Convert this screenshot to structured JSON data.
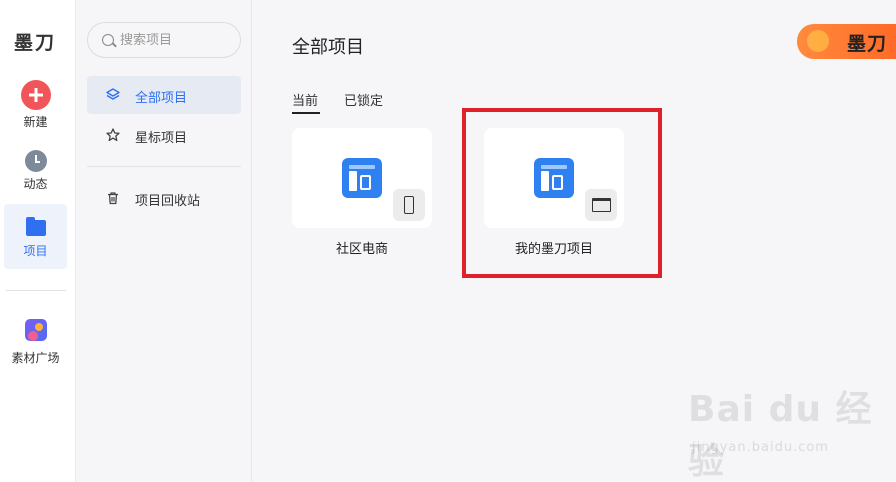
{
  "rail": {
    "logo": "墨刀",
    "items": [
      {
        "label": "新建"
      },
      {
        "label": "动态"
      },
      {
        "label": "项目"
      },
      {
        "label": "素材广场"
      }
    ]
  },
  "sidebar": {
    "search": {
      "placeholder": "搜索项目"
    },
    "nav": [
      {
        "label": "全部项目"
      },
      {
        "label": "星标项目"
      },
      {
        "label": "项目回收站"
      }
    ]
  },
  "main": {
    "title": "全部项目",
    "banner_text": "墨刀",
    "tabs": [
      {
        "label": "当前"
      },
      {
        "label": "已锁定"
      }
    ],
    "projects": [
      {
        "name": "社区电商",
        "device": "phone-icon"
      },
      {
        "name": "我的墨刀项目",
        "device": "monitor-icon"
      }
    ]
  },
  "watermark": {
    "text": "Bai du 经验",
    "sub": "jingyan.baidu.com"
  },
  "colors": {
    "accent": "#2f6ff0",
    "new_button": "#f1555a",
    "highlight": "#e0202a",
    "app_icon": "#2f80f0"
  }
}
